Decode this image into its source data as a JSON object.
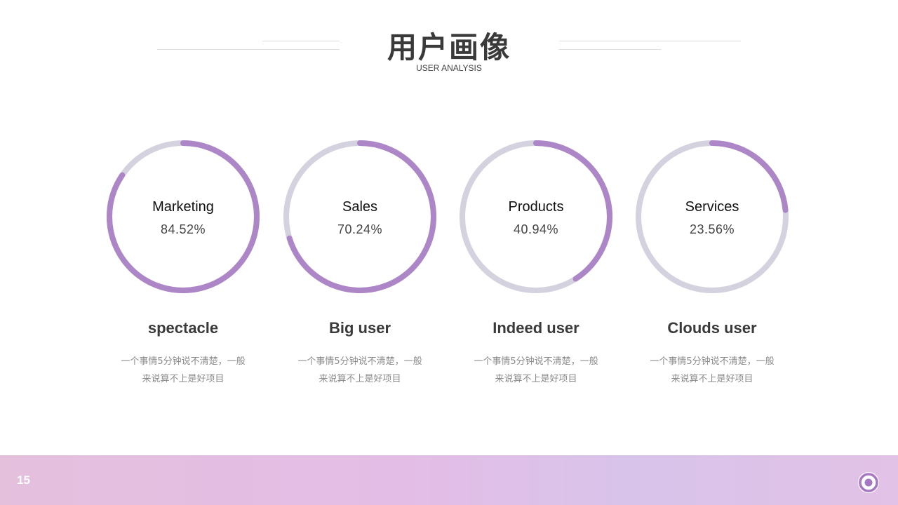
{
  "header": {
    "title": "用户画像",
    "subtitle": "USER ANALYSIS"
  },
  "colors": {
    "accent": "#ac86c6",
    "track": "#d5d2df"
  },
  "cards": [
    {
      "label": "Marketing",
      "value_text": "84.52%",
      "percent": 84.52,
      "title": "spectacle",
      "desc_line1": "一个事情5分钟说不清楚，一般",
      "desc_line2": "来说算不上是好项目"
    },
    {
      "label": "Sales",
      "value_text": "70.24%",
      "percent": 70.24,
      "title": "Big user",
      "desc_line1": "一个事情5分钟说不清楚，一般",
      "desc_line2": "来说算不上是好项目"
    },
    {
      "label": "Products",
      "value_text": "40.94%",
      "percent": 40.94,
      "title": "Indeed user",
      "desc_line1": "一个事情5分钟说不清楚，一般",
      "desc_line2": "来说算不上是好项目"
    },
    {
      "label": "Services",
      "value_text": "23.56%",
      "percent": 23.56,
      "title": "Clouds user",
      "desc_line1": "一个事情5分钟说不清楚，一般",
      "desc_line2": "来说算不上是好项目"
    }
  ],
  "footer": {
    "page_number": "15",
    "logo_icon": "ring-logo-icon"
  }
}
